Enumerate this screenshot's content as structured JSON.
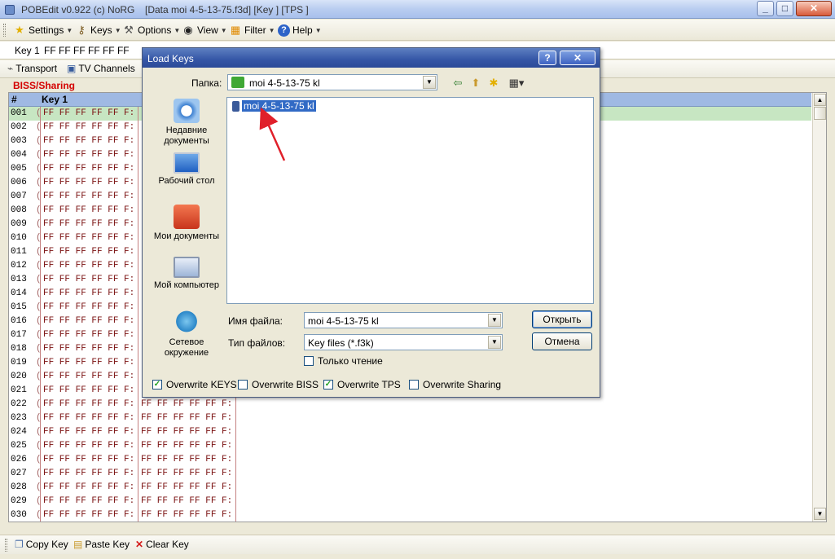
{
  "window": {
    "title_left": "POBEdit v0.922 (c) NoRG",
    "title_right": "[Data moi 4-5-13-75.f3d]  [Key ]  [TPS ]",
    "btn_min": "_",
    "btn_max": "□",
    "btn_close": "✕"
  },
  "menu": {
    "settings": "Settings",
    "keys": "Keys",
    "options": "Options",
    "view": "View",
    "filter": "Filter",
    "help": "Help"
  },
  "keybar": {
    "label": "Key 1",
    "value": "FF FF FF FF FF FF"
  },
  "nav": {
    "transport": "Transport",
    "tv_channels": "TV Channels"
  },
  "section_title": "BISS/Sharing",
  "grid": {
    "col_num": "#",
    "col_key1": "Key 1",
    "paren": "(",
    "key_value": "FF FF FF FF FF F:",
    "rows": [
      "001",
      "002",
      "003",
      "004",
      "005",
      "006",
      "007",
      "008",
      "009",
      "010",
      "011",
      "012",
      "013",
      "014",
      "015",
      "016",
      "017",
      "018",
      "019",
      "020",
      "021",
      "022",
      "023",
      "024",
      "025",
      "026",
      "027",
      "028",
      "029",
      "030"
    ]
  },
  "bottom": {
    "copy": "Copy Key",
    "paste": "Paste Key",
    "clear": "Clear Key"
  },
  "dialog": {
    "title": "Load Keys",
    "help_btn": "?",
    "close_btn": "✕",
    "folder_label": "Папка:",
    "folder_value": "moi 4-5-13-75 kl",
    "places": [
      {
        "l1": "Недавние",
        "l2": "документы"
      },
      {
        "l1": "Рабочий стол",
        "l2": ""
      },
      {
        "l1": "Мои документы",
        "l2": ""
      },
      {
        "l1": "Мой компьютер",
        "l2": ""
      },
      {
        "l1": "Сетевое",
        "l2": "окружение"
      }
    ],
    "file_selected": "moi 4-5-13-75 kl",
    "filename_label": "Имя файла:",
    "filename_value": "moi 4-5-13-75 kl",
    "filetype_label": "Тип файлов:",
    "filetype_value": "Key files (*.f3k)",
    "readonly_label": "Только чтение",
    "open_btn": "Открыть",
    "cancel_btn": "Отмена",
    "ow_keys": "Overwrite KEYS",
    "ow_biss": "Overwrite BISS",
    "ow_tps": "Overwrite TPS",
    "ow_sharing": "Overwrite Sharing",
    "checks": {
      "keys": true,
      "biss": false,
      "tps": true,
      "sharing": false,
      "readonly": false
    }
  },
  "colors": {
    "selected_row": "#c7e6c2",
    "header": "#9fb9e3",
    "section_title": "#d40000",
    "arrow": "#e0202a"
  }
}
